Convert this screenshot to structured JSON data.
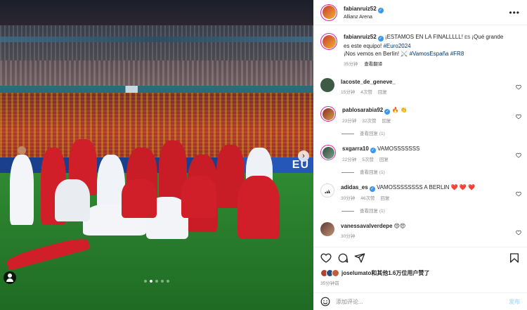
{
  "post": {
    "author": "fabianruiz52",
    "location": "Allianz Arena",
    "more_icon": "more-horizontal-icon",
    "verified_icon": "verified-badge-icon"
  },
  "media": {
    "stadium_board_text": "EU",
    "carousel_dots": 5,
    "carousel_active_index": 1,
    "next_icon": "chevron-right-icon",
    "tag_icon": "user-tag-icon"
  },
  "caption": {
    "username": "fabianruiz52",
    "text_part1": "¡ESTAMOS EN LA FINALLLLL! ",
    "es_label": "ES",
    "text_part2": " ¡Qué grande es este equipo! ",
    "hashtag1": "#Euro2024",
    "line2_text": "¡Nos vemos en Berlín! ",
    "swords": "⚔️",
    "hashtag2": "#VamosEspaña",
    "hashtag3": "#FR8",
    "time": "35分钟",
    "translate": "查看翻译"
  },
  "comments": [
    {
      "username": "lacoste_de_geneve_",
      "text": "",
      "time": "15分钟",
      "likes": "4次赞",
      "reply": "回复",
      "avatar_color": "#3c5a45",
      "verified": false,
      "story_ring": false
    },
    {
      "username": "pablosarabia92",
      "text": "🔥 👏",
      "time": "23分钟",
      "likes": "32次赞",
      "reply": "回复",
      "avatar_color": "#b73d2e",
      "verified": true,
      "story_ring": true,
      "replies": "查看回复 (1)"
    },
    {
      "username": "sxgarra10",
      "text": "VAMOSSSSSSS",
      "time": "22分钟",
      "likes": "5次赞",
      "reply": "回复",
      "avatar_color": "#4a6d57",
      "verified": true,
      "story_ring": true,
      "replies": "查看回复 (1)"
    },
    {
      "username": "adidas_es",
      "text": "VAMOSSSSSSSS A BERLIN ❤️ ❤️ ❤️",
      "time": "30分钟",
      "likes": "46次赞",
      "reply": "回复",
      "avatar_color": "#ffffff",
      "verified": true,
      "story_ring": false,
      "replies": "查看回复 (1)"
    },
    {
      "username": "vanessavalverdepe",
      "text": "😍😍",
      "time": "30分钟",
      "likes": "",
      "reply": "",
      "avatar_color": "#7a5040",
      "verified": false,
      "story_ring": false
    }
  ],
  "actions": {
    "like_icon": "heart-icon",
    "comment_icon": "comment-icon",
    "share_icon": "send-icon",
    "save_icon": "bookmark-icon",
    "liked_by_user": "joselumato",
    "liked_by_rest": "和其他1.6万位用户赞了",
    "post_time": "35分钟前"
  },
  "add_comment": {
    "placeholder": "添加评论...",
    "post_label": "发布",
    "emoji_icon": "emoji-smile-icon"
  },
  "colors": {
    "verified": "#3897f0",
    "link": "#00376b",
    "muted": "#8e8e8e",
    "post_button": "#b2dffc",
    "heart_red": "#ed4956"
  }
}
